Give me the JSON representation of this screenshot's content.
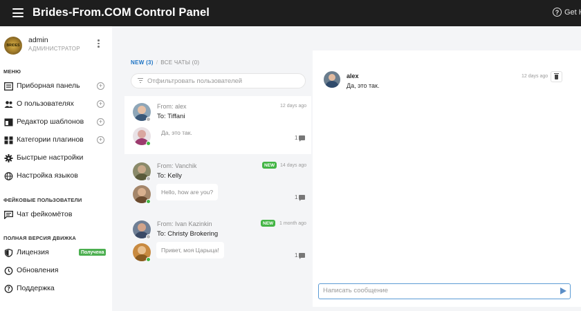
{
  "app": {
    "title": "Brides-From.COM Control Panel",
    "help_label": "Get H"
  },
  "user": {
    "logo_text": "BRIDES",
    "name": "admin",
    "role": "АДМИНИСТРАТОР"
  },
  "sidebar": {
    "sections": [
      {
        "label": "МЕНЮ"
      },
      {
        "label": "ФЕЙКОВЫЕ ПОЛЬЗОВАТЕЛИ"
      },
      {
        "label": "ПОЛНАЯ ВЕРСИЯ ДВИЖКА"
      }
    ],
    "menu": [
      {
        "label": "Приборная панель",
        "icon": "dashboard-icon"
      },
      {
        "label": "О пользователях",
        "icon": "users-icon"
      },
      {
        "label": "Редактор шаблонов",
        "icon": "template-icon"
      },
      {
        "label": "Категории плагинов",
        "icon": "plugins-icon"
      },
      {
        "label": "Быстрые настройки",
        "icon": "gear-icon"
      },
      {
        "label": "Настройка языков",
        "icon": "globe-icon"
      }
    ],
    "fake": [
      {
        "label": "Чат фейкомётов",
        "icon": "chat-icon"
      }
    ],
    "full": [
      {
        "label": "Лицензия",
        "icon": "shield-icon",
        "badge": "Получена"
      },
      {
        "label": "Обновления",
        "icon": "refresh-icon"
      },
      {
        "label": "Поддержка",
        "icon": "help-circle-icon"
      }
    ]
  },
  "tabs": {
    "new": "NEW (3)",
    "separator": "/",
    "all": "ВСЕ ЧАТЫ (0)"
  },
  "filter": {
    "placeholder": "Отфильтровать пользователей"
  },
  "threads": [
    {
      "from": "From: alex",
      "to": "To: Tiffani",
      "time": "12 days ago",
      "new_badge": "",
      "preview": "Да, это так.",
      "count": "1"
    },
    {
      "from": "From: Vanchik",
      "to": "To: Kelly",
      "time": "14 days ago",
      "new_badge": "NEW",
      "preview": "Hello, how are you?",
      "count": "1"
    },
    {
      "from": "From: Ivan Kazinkin",
      "to": "To: Christy Brokering",
      "time": "1 month ago",
      "new_badge": "NEW",
      "preview": "Привет, моя Царыца!",
      "count": "1"
    }
  ],
  "chat": {
    "name": "alex",
    "text": "Да, это так.",
    "time": "12 days ago",
    "composer_placeholder": "Написать сообщение"
  },
  "colors": {
    "topbar": "#1e1e1e",
    "accent_blue": "#1c73c4",
    "online_green": "#43b545",
    "license_badge": "#4caf50"
  }
}
